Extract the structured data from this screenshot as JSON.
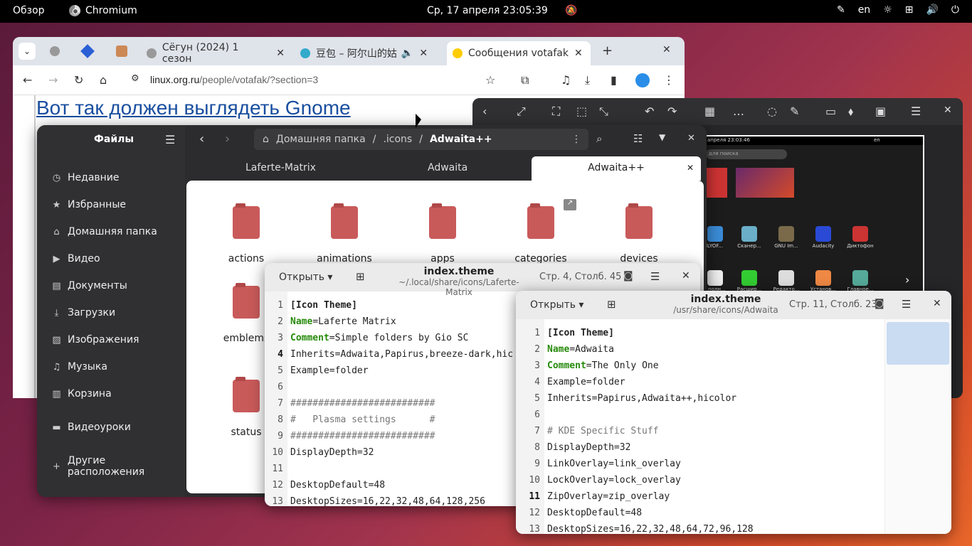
{
  "topbar": {
    "overview": "Обзор",
    "app": "Chromium",
    "clock": "Ср, 17 апреля  23:05:39",
    "lang": "en"
  },
  "browser": {
    "tabs": [
      {
        "label": "Сёгун (2024) 1 сезон"
      },
      {
        "label": "豆包 – 阿尔山的姑"
      },
      {
        "label": "Сообщения votafak"
      }
    ],
    "url_main": "linux.org.ru",
    "url_rest": "/people/votafak/?section=3",
    "heading": "Вот так должен выглядеть Gnome"
  },
  "files": {
    "title": "Файлы",
    "sidebar": [
      {
        "label": "Недавние",
        "icon": "clock-icon"
      },
      {
        "label": "Избранные",
        "icon": "star-icon"
      },
      {
        "label": "Домашняя папка",
        "icon": "home-icon"
      },
      {
        "label": "Видео",
        "icon": "video-icon"
      },
      {
        "label": "Документы",
        "icon": "document-icon"
      },
      {
        "label": "Загрузки",
        "icon": "download-icon"
      },
      {
        "label": "Изображения",
        "icon": "image-icon"
      },
      {
        "label": "Музыка",
        "icon": "music-icon"
      },
      {
        "label": "Корзина",
        "icon": "trash-icon"
      },
      {
        "label": "Видеоуроки",
        "icon": "folder-icon"
      },
      {
        "label": "Другие расположения",
        "icon": "plus-icon"
      }
    ],
    "path": [
      "Домашняя папка",
      ".icons",
      "Adwaita++"
    ],
    "tabs": [
      "Laferte-Matrix",
      "Adwaita",
      "Adwaita++"
    ],
    "folders": [
      "actions",
      "animations",
      "apps",
      "categories",
      "devices",
      "emblems",
      "status"
    ]
  },
  "editor1": {
    "open": "Открыть",
    "name": "index.theme",
    "path": "~/.local/share/icons/Laferte-Matrix",
    "pos": "Стр. 4, Столб. 45",
    "lines": [
      {
        "n": "1",
        "k": "",
        "t": "[Icon Theme]"
      },
      {
        "n": "2",
        "k": "Name",
        "t": "=Laferte Matrix"
      },
      {
        "n": "3",
        "k": "Comment",
        "t": "=Simple folders by Gio SC"
      },
      {
        "n": "4",
        "k": "",
        "t": "Inherits=Adwaita,Papirus,breeze-dark,hic"
      },
      {
        "n": "5",
        "k": "",
        "t": "Example=folder"
      },
      {
        "n": "6",
        "k": "",
        "t": ""
      },
      {
        "n": "7",
        "k": "",
        "t": "##########################"
      },
      {
        "n": "8",
        "k": "",
        "t": "#   Plasma settings      #"
      },
      {
        "n": "9",
        "k": "",
        "t": "##########################"
      },
      {
        "n": "10",
        "k": "",
        "t": "DisplayDepth=32"
      },
      {
        "n": "11",
        "k": "",
        "t": ""
      },
      {
        "n": "12",
        "k": "",
        "t": "DesktopDefault=48"
      },
      {
        "n": "13",
        "k": "",
        "t": "DesktopSizes=16,22,32,48,64,128,256"
      }
    ]
  },
  "editor2": {
    "open": "Открыть",
    "name": "index.theme",
    "path": "/usr/share/icons/Adwaita",
    "pos": "Стр. 11, Столб. 23",
    "lines": [
      {
        "n": "1",
        "k": "",
        "t": "[Icon Theme]"
      },
      {
        "n": "2",
        "k": "Name",
        "t": "=Adwaita"
      },
      {
        "n": "3",
        "k": "Comment",
        "t": "=The Only One"
      },
      {
        "n": "4",
        "k": "",
        "t": "Example=folder"
      },
      {
        "n": "5",
        "k": "",
        "t": "Inherits=Papirus,Adwaita++,hicolor"
      },
      {
        "n": "6",
        "k": "",
        "t": ""
      },
      {
        "n": "7",
        "k": "",
        "t": "# KDE Specific Stuff"
      },
      {
        "n": "8",
        "k": "",
        "t": "DisplayDepth=32"
      },
      {
        "n": "9",
        "k": "",
        "t": "LinkOverlay=link_overlay"
      },
      {
        "n": "10",
        "k": "",
        "t": "LockOverlay=lock_overlay"
      },
      {
        "n": "11",
        "k": "",
        "t": "ZipOverlay=zip_overlay"
      },
      {
        "n": "12",
        "k": "",
        "t": "DesktopDefault=48"
      },
      {
        "n": "13",
        "k": "",
        "t": "DesktopSizes=16,22,32,48,64,72,96,128"
      }
    ]
  },
  "viewer": {
    "shot_clock": "апреля  23:03:46",
    "shot_search": "для поиска",
    "shot_lang": "en",
    "apps_row1": [
      "ILYOF...",
      "Сканер...",
      "GNU Im...",
      "Audacity",
      "Диктофон"
    ],
    "apps_row2": [
      "...полн...",
      "Расшир...",
      "Редакто...",
      "Установ...",
      "Главное..."
    ]
  }
}
